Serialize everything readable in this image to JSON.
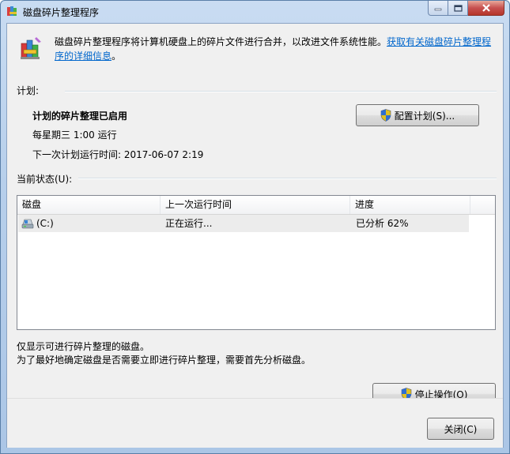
{
  "window": {
    "title": "磁盘碎片整理程序"
  },
  "intro": {
    "text": "磁盘碎片整理程序将计算机硬盘上的碎片文件进行合并，以改进文件系统性能。",
    "link": "获取有关磁盘碎片整理程序的详细信息",
    "tail": "。"
  },
  "schedule": {
    "label": "计划:",
    "status": "计划的碎片整理已启用",
    "frequency": "每星期三  1:00 运行",
    "next_run": "下一次计划运行时间: 2017-06-07 2:19",
    "configure_button": "配置计划(S)..."
  },
  "current_status": {
    "label": "当前状态(U):",
    "columns": [
      "磁盘",
      "上一次运行时间",
      "进度"
    ],
    "rows": [
      {
        "disk": "(C:)",
        "last_run": "正在运行...",
        "progress": "已分析 62%"
      }
    ]
  },
  "notes": {
    "line1": "仅显示可进行碎片整理的磁盘。",
    "line2": "为了最好地确定磁盘是否需要立即进行碎片整理，需要首先分析磁盘。"
  },
  "buttons": {
    "stop": "停止操作(O)",
    "close": "关闭(C)"
  }
}
